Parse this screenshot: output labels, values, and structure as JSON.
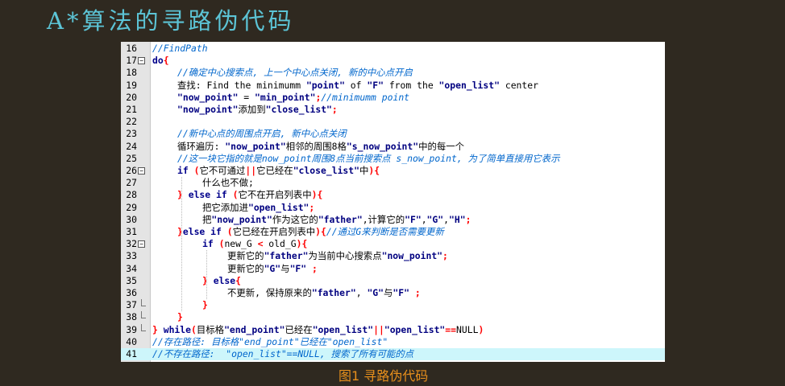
{
  "title": "A*算法的寻路伪代码",
  "caption": "图1 寻路伪代码",
  "highlighted_line": 41,
  "lines": [
    {
      "n": "16",
      "fold": "",
      "indent": 0,
      "segs": [
        [
          "cm",
          "//FindPath"
        ]
      ]
    },
    {
      "n": "17",
      "fold": "open",
      "indent": 0,
      "segs": [
        [
          "kw",
          "do"
        ],
        [
          "op",
          "{"
        ]
      ]
    },
    {
      "n": "18",
      "fold": "",
      "indent": 1,
      "segs": [
        [
          "cm",
          "//确定中心搜索点, 上一个中心点关闭, 新的中心点开启"
        ]
      ]
    },
    {
      "n": "19",
      "fold": "",
      "indent": 1,
      "segs": [
        [
          "tx",
          "查找: Find the minimumm "
        ],
        [
          "st",
          "\"point\""
        ],
        [
          "tx",
          " of "
        ],
        [
          "st",
          "\"F\""
        ],
        [
          "tx",
          " from the "
        ],
        [
          "st",
          "\"open_list\""
        ],
        [
          "tx",
          " center"
        ]
      ]
    },
    {
      "n": "20",
      "fold": "",
      "indent": 1,
      "segs": [
        [
          "st",
          "\"now_point\""
        ],
        [
          "tx",
          " = "
        ],
        [
          "st",
          "\"min_point\""
        ],
        [
          "op",
          ";"
        ],
        [
          "cm",
          "//minimumm point"
        ]
      ]
    },
    {
      "n": "21",
      "fold": "",
      "indent": 1,
      "segs": [
        [
          "st",
          "\"now_point\""
        ],
        [
          "tx",
          "添加到"
        ],
        [
          "st",
          "\"close_list\""
        ],
        [
          "op",
          ";"
        ]
      ]
    },
    {
      "n": "22",
      "fold": "",
      "indent": 0,
      "segs": []
    },
    {
      "n": "23",
      "fold": "",
      "indent": 1,
      "segs": [
        [
          "cm",
          "//新中心点的周围点开启, 新中心点关闭"
        ]
      ]
    },
    {
      "n": "24",
      "fold": "",
      "indent": 1,
      "segs": [
        [
          "tx",
          "循环遍历: "
        ],
        [
          "st",
          "\"now_point\""
        ],
        [
          "tx",
          "相邻的周围8格"
        ],
        [
          "st",
          "\"s_now_point\""
        ],
        [
          "tx",
          "中的每一个"
        ]
      ]
    },
    {
      "n": "25",
      "fold": "",
      "indent": 1,
      "segs": [
        [
          "cm",
          "//这一块它指的就是now_point周围8点当前搜索点 s_now_point, 为了简单直接用它表示"
        ]
      ]
    },
    {
      "n": "26",
      "fold": "open",
      "indent": 1,
      "segs": [
        [
          "kw",
          "if"
        ],
        [
          "tx",
          " "
        ],
        [
          "op",
          "("
        ],
        [
          "tx",
          "它不可通过"
        ],
        [
          "op",
          "||"
        ],
        [
          "tx",
          "它已经在"
        ],
        [
          "st",
          "\"close_list\""
        ],
        [
          "tx",
          "中"
        ],
        [
          "op",
          ")"
        ],
        [
          "op",
          "{"
        ]
      ]
    },
    {
      "n": "27",
      "fold": "",
      "indent": 2,
      "segs": [
        [
          "tx",
          "什么也不做;"
        ]
      ]
    },
    {
      "n": "28",
      "fold": "",
      "indent": 1,
      "segs": [
        [
          "op",
          "}"
        ],
        [
          "tx",
          " "
        ],
        [
          "kw",
          "else if"
        ],
        [
          "tx",
          " "
        ],
        [
          "op",
          "("
        ],
        [
          "tx",
          "它不在开启列表中"
        ],
        [
          "op",
          ")"
        ],
        [
          "op",
          "{"
        ]
      ]
    },
    {
      "n": "29",
      "fold": "",
      "indent": 2,
      "segs": [
        [
          "tx",
          "把它添加进"
        ],
        [
          "st",
          "\"open_list\""
        ],
        [
          "op",
          ";"
        ]
      ]
    },
    {
      "n": "30",
      "fold": "",
      "indent": 2,
      "segs": [
        [
          "tx",
          "把"
        ],
        [
          "st",
          "\"now_point\""
        ],
        [
          "tx",
          "作为这它的"
        ],
        [
          "st",
          "\"father\""
        ],
        [
          "tx",
          ",计算它的"
        ],
        [
          "st",
          "\"F\""
        ],
        [
          "tx",
          ","
        ],
        [
          "st",
          "\"G\""
        ],
        [
          "tx",
          ","
        ],
        [
          "st",
          "\"H\""
        ],
        [
          "op",
          ";"
        ]
      ]
    },
    {
      "n": "31",
      "fold": "",
      "indent": 1,
      "segs": [
        [
          "op",
          "}"
        ],
        [
          "kw",
          "else if"
        ],
        [
          "tx",
          " "
        ],
        [
          "op",
          "("
        ],
        [
          "tx",
          "它已经在开启列表中"
        ],
        [
          "op",
          ")"
        ],
        [
          "op",
          "{"
        ],
        [
          "cm",
          "//通过G来判断是否需要更新"
        ]
      ]
    },
    {
      "n": "32",
      "fold": "open",
      "indent": 2,
      "segs": [
        [
          "kw",
          "if"
        ],
        [
          "tx",
          " "
        ],
        [
          "op",
          "("
        ],
        [
          "tx",
          "new_G "
        ],
        [
          "op",
          "<"
        ],
        [
          "tx",
          " old_G"
        ],
        [
          "op",
          ")"
        ],
        [
          "op",
          "{"
        ]
      ]
    },
    {
      "n": "33",
      "fold": "",
      "indent": 3,
      "segs": [
        [
          "tx",
          "更新它的"
        ],
        [
          "st",
          "\"father\""
        ],
        [
          "tx",
          "为当前中心搜索点"
        ],
        [
          "st",
          "\"now_point\""
        ],
        [
          "op",
          ";"
        ]
      ]
    },
    {
      "n": "34",
      "fold": "",
      "indent": 3,
      "segs": [
        [
          "tx",
          "更新它的"
        ],
        [
          "st",
          "\"G\""
        ],
        [
          "tx",
          "与"
        ],
        [
          "st",
          "\"F\""
        ],
        [
          "tx",
          " "
        ],
        [
          "op",
          ";"
        ]
      ]
    },
    {
      "n": "35",
      "fold": "",
      "indent": 2,
      "segs": [
        [
          "op",
          "}"
        ],
        [
          "tx",
          " "
        ],
        [
          "kw",
          "else"
        ],
        [
          "op",
          "{"
        ]
      ]
    },
    {
      "n": "36",
      "fold": "",
      "indent": 3,
      "segs": [
        [
          "tx",
          "不更新, 保持原来的"
        ],
        [
          "st",
          "\"father\""
        ],
        [
          "tx",
          ", "
        ],
        [
          "st",
          "\"G\""
        ],
        [
          "tx",
          "与"
        ],
        [
          "st",
          "\"F\""
        ],
        [
          "tx",
          " "
        ],
        [
          "op",
          ";"
        ]
      ]
    },
    {
      "n": "37",
      "fold": "end",
      "indent": 2,
      "segs": [
        [
          "op",
          "}"
        ]
      ]
    },
    {
      "n": "38",
      "fold": "end",
      "indent": 1,
      "segs": [
        [
          "op",
          "}"
        ]
      ]
    },
    {
      "n": "39",
      "fold": "end",
      "indent": 0,
      "segs": [
        [
          "op",
          "}"
        ],
        [
          "tx",
          " "
        ],
        [
          "kw",
          "while"
        ],
        [
          "op",
          "("
        ],
        [
          "tx",
          "目标格"
        ],
        [
          "st",
          "\"end_point\""
        ],
        [
          "tx",
          "已经在"
        ],
        [
          "st",
          "\"open_list\""
        ],
        [
          "op",
          "||"
        ],
        [
          "st",
          "\"open_list\""
        ],
        [
          "op",
          "=="
        ],
        [
          "tx",
          "NULL"
        ],
        [
          "op",
          ")"
        ]
      ]
    },
    {
      "n": "40",
      "fold": "",
      "indent": 0,
      "segs": [
        [
          "cm",
          "//存在路径: 目标格\"end_point\"已经在\"open_list\""
        ]
      ]
    },
    {
      "n": "41",
      "fold": "",
      "indent": 0,
      "segs": [
        [
          "cm",
          "//不存在路径:  \"open_list\"==NULL, 搜索了所有可能的点"
        ]
      ]
    }
  ]
}
